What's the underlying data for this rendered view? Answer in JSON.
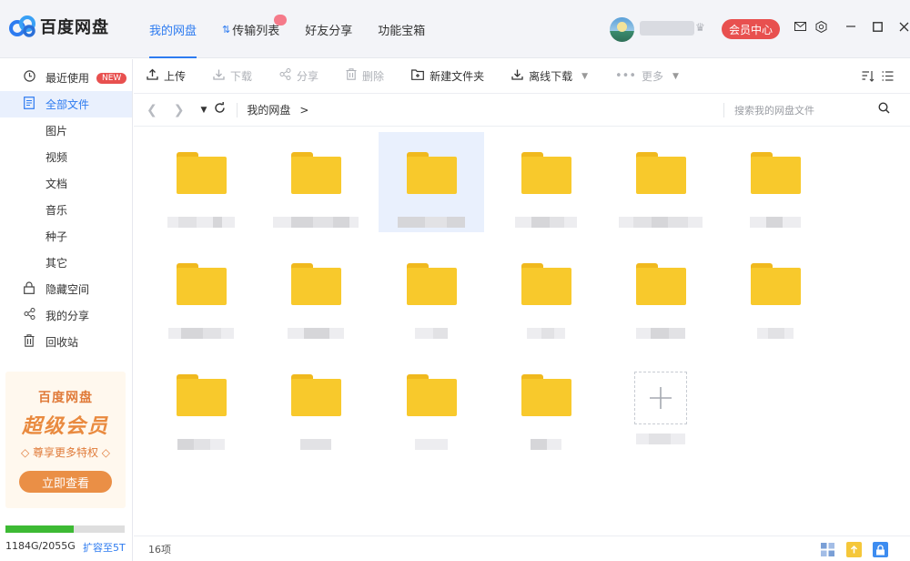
{
  "app": {
    "name": "百度网盘",
    "colors": {
      "accent": "#2d7bf0",
      "vip": "#e8504f",
      "folder": "#f8c92c",
      "storage": "#3dba34"
    }
  },
  "nav": {
    "tabs": [
      {
        "label": "我的网盘",
        "active": true
      },
      {
        "label": "传输列表"
      },
      {
        "label": "好友分享"
      },
      {
        "label": "功能宝箱"
      }
    ]
  },
  "user": {
    "vip_button": "会员中心"
  },
  "window_controls": [
    "mail-icon",
    "settings-icon",
    "minimize-icon",
    "maximize-icon",
    "close-icon"
  ],
  "sidebar": {
    "items": [
      {
        "label": "最近使用",
        "icon": "clock-icon",
        "badge": "NEW"
      },
      {
        "label": "全部文件",
        "icon": "file-icon",
        "active": true
      },
      {
        "label": "图片"
      },
      {
        "label": "视频"
      },
      {
        "label": "文档"
      },
      {
        "label": "音乐"
      },
      {
        "label": "种子"
      },
      {
        "label": "其它"
      },
      {
        "label": "隐藏空间",
        "icon": "lock-icon"
      },
      {
        "label": "我的分享",
        "icon": "share-icon"
      },
      {
        "label": "回收站",
        "icon": "trash-icon"
      }
    ],
    "promo": {
      "brand": "百度网盘",
      "title": "超级会员",
      "subtitle": "◇ 尊享更多特权 ◇",
      "button": "立即查看"
    },
    "storage": {
      "used_fraction": 0.576,
      "text": "1184G/2055G",
      "expand_label": "扩容至5T"
    }
  },
  "toolbar": {
    "upload": "上传",
    "download": "下载",
    "share": "分享",
    "delete": "删除",
    "new_folder": "新建文件夹",
    "offline_download": "离线下载",
    "more": "更多"
  },
  "pathbar": {
    "crumb": "我的网盘",
    "arrow": ">",
    "search_placeholder": "搜索我的网盘文件"
  },
  "files": {
    "count_text": "16项"
  }
}
